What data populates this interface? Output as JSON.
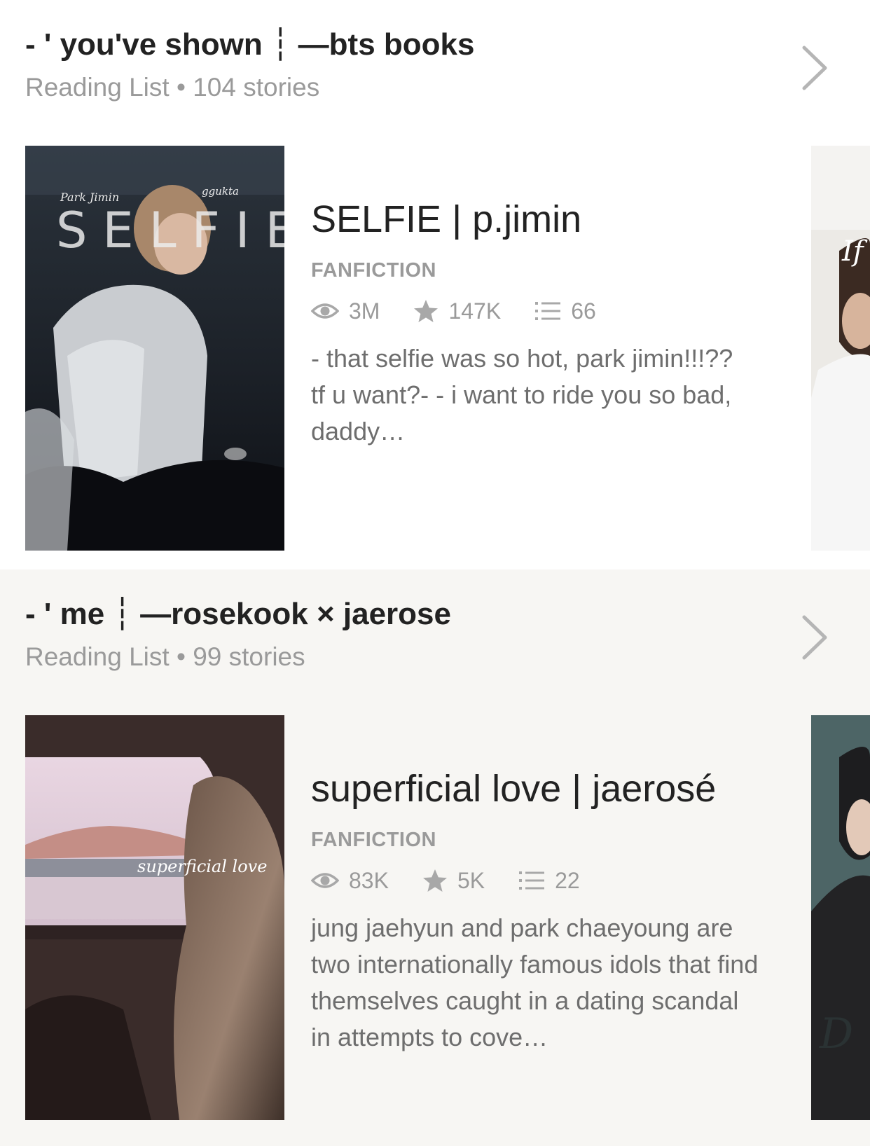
{
  "lists": [
    {
      "title": "- ' you've shown  ┆ —bts books",
      "subtitle": "Reading List • 104 stories",
      "story": {
        "cover_text": {
          "top_left": "Park Jimin",
          "top_right": "ggukta",
          "word": "SELFIE"
        },
        "title": "SELFIE | p.jimin",
        "category": "FANFICTION",
        "views": "3M",
        "votes": "147K",
        "parts": "66",
        "description": "- that selfie was so hot, park jimin!!!??\ntf u want?- - i want to ride you so bad, daddy…"
      },
      "peek_text": "If"
    },
    {
      "title": "- ' me  ┆ —rosekook × jaerose",
      "subtitle": "Reading List • 99 stories",
      "story": {
        "cover_text": {
          "word": "superficial love"
        },
        "title": "superficial love | jaerosé",
        "category": "FANFICTION",
        "views": "83K",
        "votes": "5K",
        "parts": "22",
        "description": "jung jaehyun and park chaeyoung are two internationally famous idols that find themselves caught in a dating scandal in attempts to cove…"
      },
      "peek_text": "D"
    }
  ],
  "icons": {
    "views": "eye-icon",
    "votes": "star-icon",
    "parts": "list-icon",
    "more": "chevron-right-icon"
  },
  "colors": {
    "text": "#222222",
    "muted": "#9a9a9a",
    "desc": "#6e6e6e",
    "section_alt_bg": "#f7f6f3"
  }
}
